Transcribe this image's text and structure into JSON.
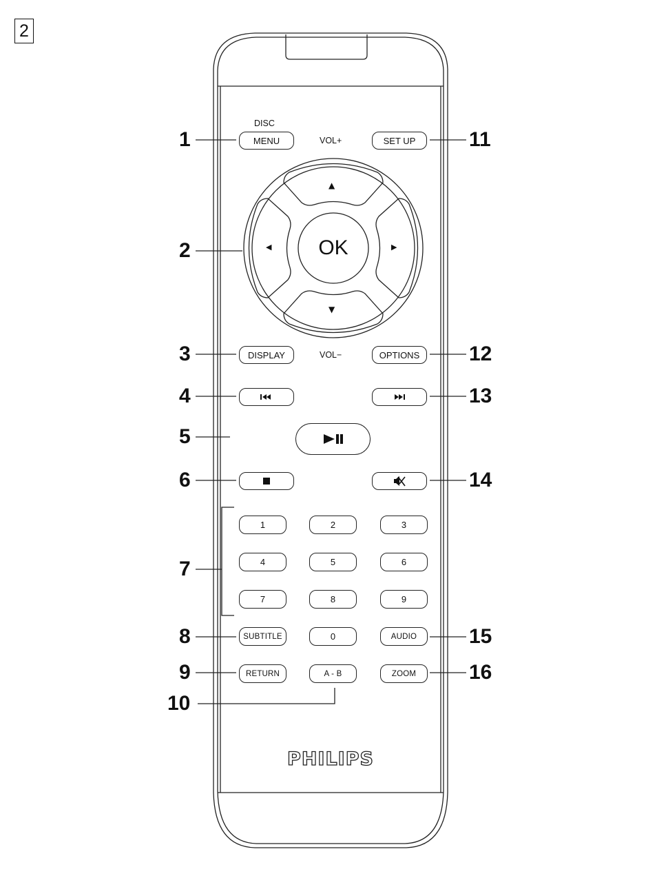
{
  "figure": {
    "number": "2"
  },
  "device": {
    "brand_logo": "PHILIPS",
    "type": "remote-control"
  },
  "labels": {
    "disc": "DISC",
    "vol_plus": "VOL+",
    "vol_minus": "VOL−"
  },
  "buttons": {
    "menu": "MENU",
    "setup": "SET UP",
    "ok": "OK",
    "up": "▲",
    "down": "▼",
    "left": "◀",
    "right": "▶",
    "display": "DISPLAY",
    "options": "OPTIONS",
    "prev": "⏮",
    "next": "⏭",
    "play_pause": "▶❙❙",
    "stop": "■",
    "mute": "🔇",
    "digits": [
      "1",
      "2",
      "3",
      "4",
      "5",
      "6",
      "7",
      "8",
      "9",
      "0"
    ],
    "subtitle": "SUBTITLE",
    "audio": "AUDIO",
    "return": "RETURN",
    "ab": "A - B",
    "zoom": "ZOOM"
  },
  "icons": {
    "prev": "skip-previous-icon",
    "next": "skip-next-icon",
    "play_pause": "play-pause-icon",
    "stop": "stop-icon",
    "mute": "mute-icon"
  },
  "callouts": [
    "1",
    "2",
    "3",
    "4",
    "5",
    "6",
    "7",
    "8",
    "9",
    "10",
    "11",
    "12",
    "13",
    "14",
    "15",
    "16"
  ]
}
